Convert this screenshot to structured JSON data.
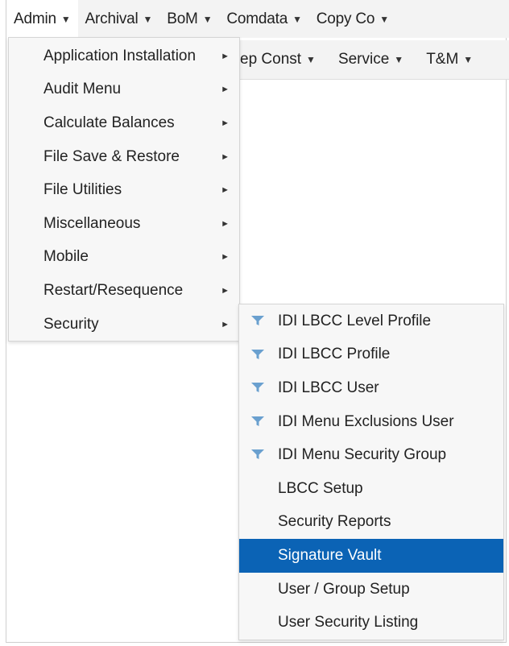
{
  "menubar": {
    "items": [
      {
        "label": "Admin",
        "caret": "▼"
      },
      {
        "label": "Archival",
        "caret": "▼"
      },
      {
        "label": "BoM",
        "caret": "▼"
      },
      {
        "label": "Comdata",
        "caret": "▼"
      },
      {
        "label": "Copy Co",
        "caret": "▼"
      }
    ]
  },
  "menubar2": {
    "items": [
      {
        "label": "ep Const",
        "caret": "▼"
      },
      {
        "label": "Service",
        "caret": "▼"
      },
      {
        "label": "T&M",
        "caret": "▼"
      }
    ]
  },
  "admin_menu": {
    "arrow": "►",
    "items": [
      {
        "label": "Application Installation"
      },
      {
        "label": "Audit Menu"
      },
      {
        "label": "Calculate Balances"
      },
      {
        "label": "File Save & Restore"
      },
      {
        "label": "File Utilities"
      },
      {
        "label": "Miscellaneous"
      },
      {
        "label": "Mobile"
      },
      {
        "label": "Restart/Resequence"
      },
      {
        "label": "Security"
      }
    ]
  },
  "security_menu": {
    "items": [
      {
        "label": "IDI LBCC Level Profile",
        "icon": "filter-icon"
      },
      {
        "label": "IDI LBCC Profile",
        "icon": "filter-icon"
      },
      {
        "label": "IDI LBCC User",
        "icon": "filter-icon"
      },
      {
        "label": "IDI Menu Exclusions User",
        "icon": "filter-icon"
      },
      {
        "label": "IDI Menu Security Group",
        "icon": "filter-icon"
      },
      {
        "label": "LBCC Setup"
      },
      {
        "label": "Security Reports"
      },
      {
        "label": "Signature Vault",
        "selected": true
      },
      {
        "label": "User / Group Setup"
      },
      {
        "label": "User Security Listing"
      }
    ]
  },
  "colors": {
    "highlight": "#0b63b5",
    "filter_icon": "#6aa0cf",
    "menubar_bg": "#f3f3f3"
  }
}
